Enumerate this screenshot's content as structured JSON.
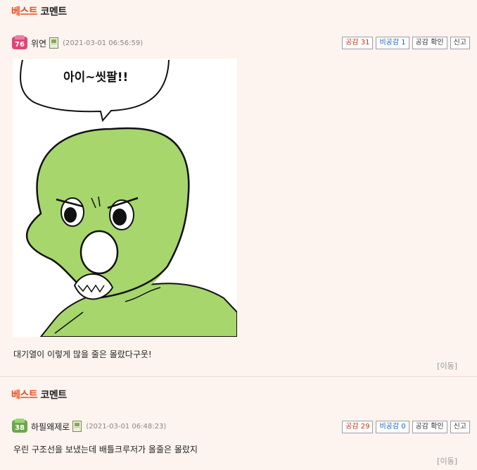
{
  "sections": [
    {
      "title_highlight": "베스트",
      "title_rest": " 코멘트",
      "comment": {
        "level": "76",
        "level_color": "#e0457a",
        "nickname": "위연",
        "date": "(2021-03-01 06:56:59)",
        "buttons": {
          "like": "공감 31",
          "dislike": "비공감 1",
          "check": "공감 확인",
          "report": "신고"
        },
        "image": {
          "speech_text": "아이~씻팔!!",
          "colors": {
            "skin": "#a6d66c",
            "outline": "#111111"
          }
        },
        "text": "대기열이 이렇게 많을 줄은 몰랐다구웃!",
        "move_label": "[이동]"
      }
    },
    {
      "title_highlight": "베스트",
      "title_rest": " 코멘트",
      "comment": {
        "level": "38",
        "level_color": "#6aa84f",
        "nickname": "하필왜제로",
        "date": "(2021-03-01 06:48:23)",
        "buttons": {
          "like": "공감 29",
          "dislike": "비공감 0",
          "check": "공감 확인",
          "report": "신고"
        },
        "text": "우린 구조선을 보냈는데 배틀크루저가 올줄은 몰랐지",
        "move_label": "[이동]"
      }
    }
  ]
}
